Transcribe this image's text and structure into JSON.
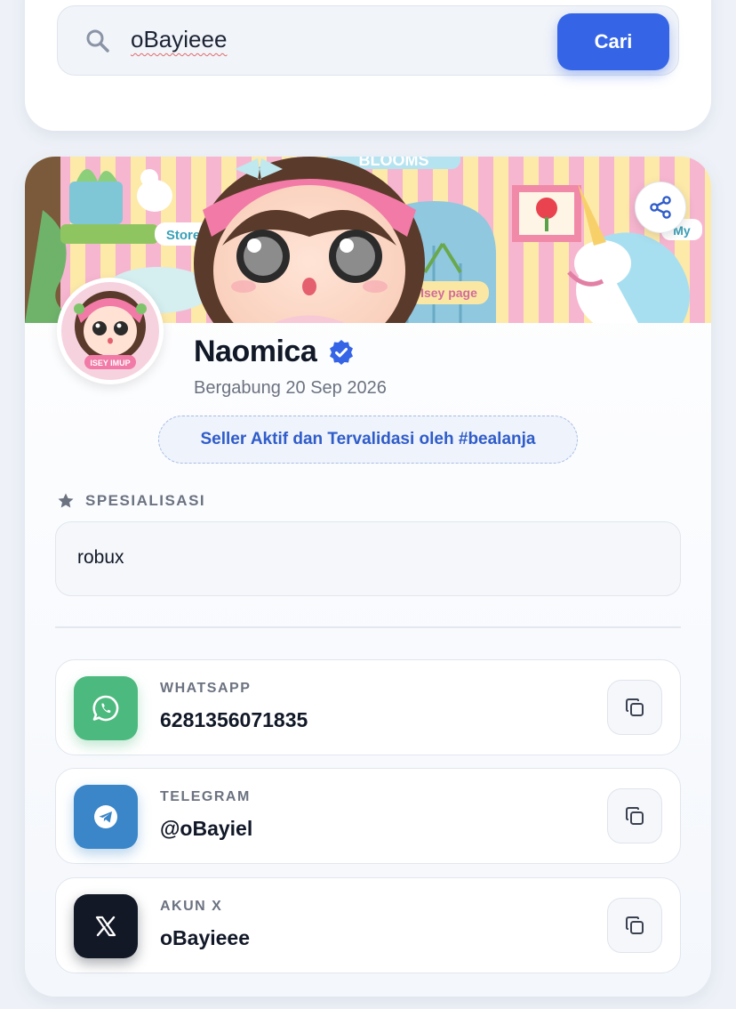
{
  "search": {
    "value": "oBayieee",
    "button_label": "Cari"
  },
  "profile": {
    "banner_texts": {
      "store": "Store",
      "isey_page": "Isey page",
      "top": "BLOOMS",
      "right": "My"
    },
    "avatar_caption": "ISEY IMUP",
    "name": "Naomica",
    "verified": true,
    "joined": "Bergabung 20 Sep 2026",
    "badge": "Seller Aktif dan Tervalidasi oleh #bealanja"
  },
  "specialization": {
    "label": "SPESIALISASI",
    "value": "robux"
  },
  "contacts": [
    {
      "label": "WHATSAPP",
      "value": "6281356071835",
      "icon": "whatsapp-icon",
      "color": "#4cb97e"
    },
    {
      "label": "TELEGRAM",
      "value": "@oBayiel",
      "icon": "telegram-icon",
      "color": "#3a86c8"
    },
    {
      "label": "AKUN X",
      "value": "oBayieee",
      "icon": "x-icon",
      "color": "#121826"
    }
  ],
  "colors": {
    "accent": "#3565e6",
    "verified": "#3565e6"
  }
}
